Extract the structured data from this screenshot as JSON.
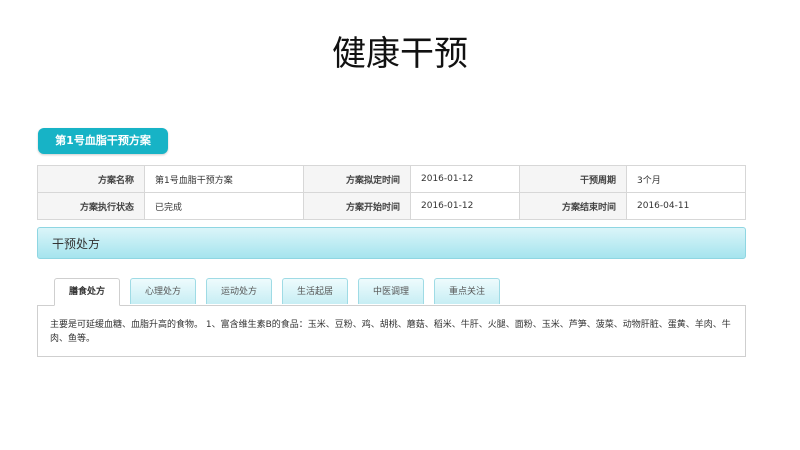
{
  "title": "健康干预",
  "plan_badge": "第1号血脂干预方案",
  "info": {
    "row1": [
      {
        "label": "方案名称",
        "value": "第1号血脂干预方案"
      },
      {
        "label": "方案拟定时间",
        "value": "2016-01-12"
      },
      {
        "label": "干预周期",
        "value": "3个月"
      }
    ],
    "row2": [
      {
        "label": "方案执行状态",
        "value": "已完成"
      },
      {
        "label": "方案开始时间",
        "value": "2016-01-12"
      },
      {
        "label": "方案结束时间",
        "value": "2016-04-11"
      }
    ]
  },
  "section_title": "干预处方",
  "tabs": [
    "膳食处方",
    "心理处方",
    "运动处方",
    "生活起居",
    "中医调理",
    "重点关注"
  ],
  "active_tab": "膳食处方",
  "content_text": "主要是可延缓血糖、血脂升高的食物。 1、富含维生素B的食品：玉米、豆粉、鸡、胡桃、蘑菇、稻米、牛肝、火腿、面粉、玉米、芦笋、菠菜、动物肝脏、蛋黄、羊肉、牛肉、鱼等。",
  "colors": {
    "accent": "#17b3c6",
    "section_bar": "#a5e4ee"
  }
}
